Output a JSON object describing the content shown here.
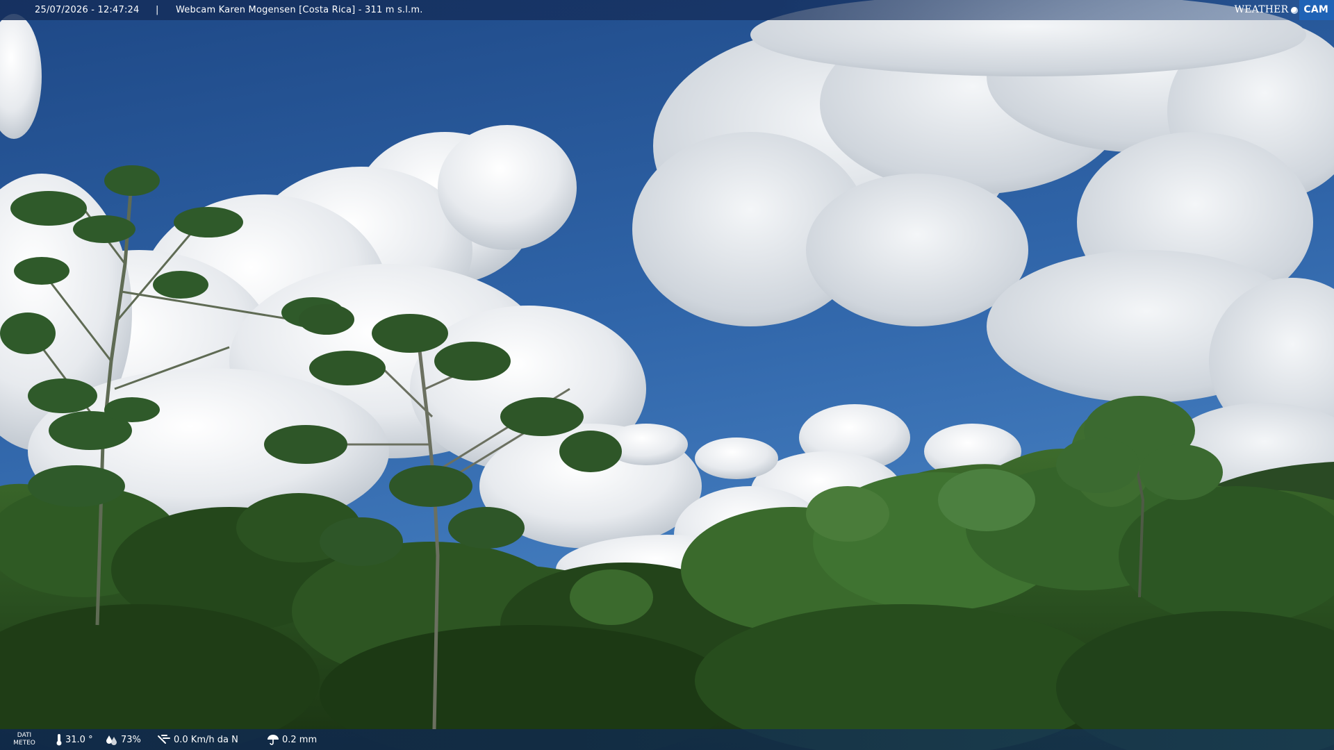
{
  "overlay_top": {
    "timestamp": "25/07/2026 - 12:47:24",
    "separator": "|",
    "title": "Webcam Karen Mogensen [Costa Rica] - 311 m s.l.m.",
    "logo_word": "WEATHER",
    "logo_cam": "CAM"
  },
  "overlay_bottom": {
    "dati_line1": "DATI",
    "dati_line2": "METEO",
    "temperature": "31.0 °",
    "humidity": "73%",
    "wind": "0.0 Km/h da N",
    "rain": "0.2 mm"
  },
  "icons": {
    "temperature": "thermometer-icon",
    "humidity": "humidity-drop-icon",
    "wind": "wind-icon",
    "rain": "rain-umbrella-icon"
  },
  "colors": {
    "sky_top": "#22508f",
    "sky_mid": "#3a72b8",
    "cloud": "#f2f4f6",
    "cloud_shadow": "#aeb6bf",
    "forest_dark": "#1f3a16",
    "forest_mid": "#2e5a22",
    "forest_light": "#4f7f3a",
    "bar": "#142d5a",
    "logo_accent": "#1f63b6"
  }
}
